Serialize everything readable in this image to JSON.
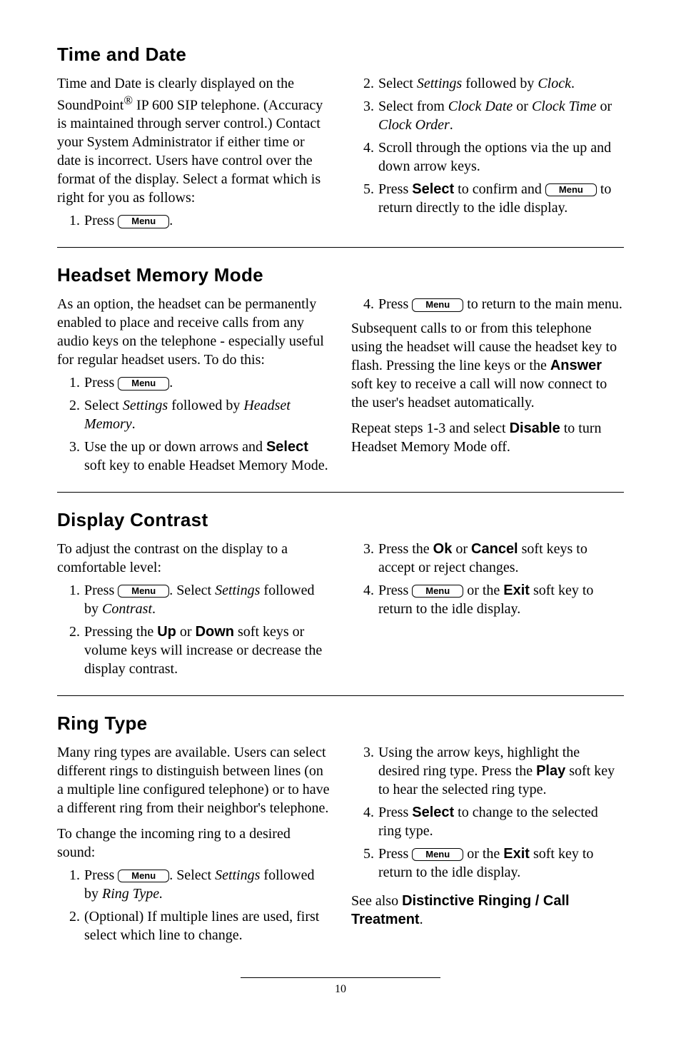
{
  "menuLabel": "Menu",
  "time": {
    "heading": "Time and Date",
    "intro_a": "Time and Date is clearly displayed on the SoundPoint",
    "intro_b": " IP 600 SIP telephone.  (Accuracy is maintained through server control.)  Contact your System Administrator if either time or date is incorrect.  Users have control over the format of the display.  Select a format which is right for you as follows:",
    "reg": "®",
    "s1_pre": "Press ",
    "s1_post": ".",
    "s2_a": "Select ",
    "s2_settings": "Settings",
    "s2_b": " followed by ",
    "s2_clock": "Clock",
    "s2_c": ".",
    "s3_a": "Select from ",
    "s3_cdate": "Clock Date",
    "s3_or": " or ",
    "s3_ctime": "Clock Time",
    "s3_or2": " or ",
    "s3_corder": "Clock Order",
    "s3_c": ".",
    "s4": "Scroll through the options via the up and down arrow keys.",
    "s5_a": "Press ",
    "s5_select": "Select",
    "s5_b": " to confirm and ",
    "s5_c": " to return directly to the idle display."
  },
  "headset": {
    "heading": "Headset Memory Mode",
    "intro": "As an option, the headset can be permanently enabled to place and receive calls from any audio keys on the telephone - especially useful for regular headset users.  To do this:",
    "s1_pre": "Press ",
    "s1_post": ".",
    "s2_a": "Select ",
    "s2_settings": "Settings",
    "s2_b": " followed by ",
    "s2_hm": "Headset Memory",
    "s2_c": ".",
    "s3_a": "Use the up or down arrows and ",
    "s3_select": "Select",
    "s3_b": " soft key to enable Headset Memory Mode.",
    "s4_a": "Press ",
    "s4_b": " to return to the main menu.",
    "r_para_a": "Subsequent calls to or from this telephone using the headset will cause the headset key to flash.  Pressing the line keys or the ",
    "r_answer": "Answer",
    "r_para_b": " soft key to receive a call will now connect to the user's headset automatically.",
    "r2_a": "Repeat steps 1-3 and select ",
    "r2_disable": "Disable",
    "r2_b": " to turn Headset Memory Mode off."
  },
  "contrast": {
    "heading": "Display Contrast",
    "intro": "To adjust the contrast on the display to a comfortable level:",
    "s1_a": "Press ",
    "s1_b": ".  Select ",
    "s1_settings": "Settings",
    "s1_c": " followed by ",
    "s1_contrast": "Contrast",
    "s1_d": ".",
    "s2_a": "Pressing the ",
    "s2_up": "Up",
    "s2_or": " or ",
    "s2_down": "Down",
    "s2_b": " soft keys or volume keys will increase or decrease the display contrast.",
    "s3_a": "Press the ",
    "s3_ok": "Ok",
    "s3_or": " or ",
    "s3_cancel": "Cancel",
    "s3_b": " soft keys to accept or reject changes.",
    "s4_a": "Press ",
    "s4_b": " or the ",
    "s4_exit": "Exit",
    "s4_c": " soft key to return to the idle display."
  },
  "ring": {
    "heading": "Ring Type",
    "intro": "Many ring types are available.  Users can select different rings to distinguish between lines (on a multiple line configured telephone) or to have a different ring from their neighbor's telephone.",
    "lead": "To change the incoming ring to a desired sound:",
    "s1_a": "Press ",
    "s1_b": ".  Select ",
    "s1_settings": "Settings",
    "s1_c": " followed by ",
    "s1_ringtype": "Ring Type.",
    "s2": "(Optional)  If multiple lines are used, first select which line to change.",
    "s3_a": "Using the arrow keys, highlight the desired ring type.  Press the ",
    "s3_play": "Play",
    "s3_b": " soft key to hear the selected ring type.",
    "s4_a": "Press ",
    "s4_select": "Select",
    "s4_b": " to change to the selected ring type.",
    "s5_a": "Press ",
    "s5_b": " or the ",
    "s5_exit": "Exit",
    "s5_c": " soft key to return to the idle display.",
    "see_a": "See also ",
    "see_b": "Distinctive Ringing / Call Treatment",
    "see_c": "."
  },
  "page": "10",
  "nums": {
    "n1": "1.",
    "n2": "2.",
    "n3": "3.",
    "n4": "4.",
    "n5": "5."
  }
}
